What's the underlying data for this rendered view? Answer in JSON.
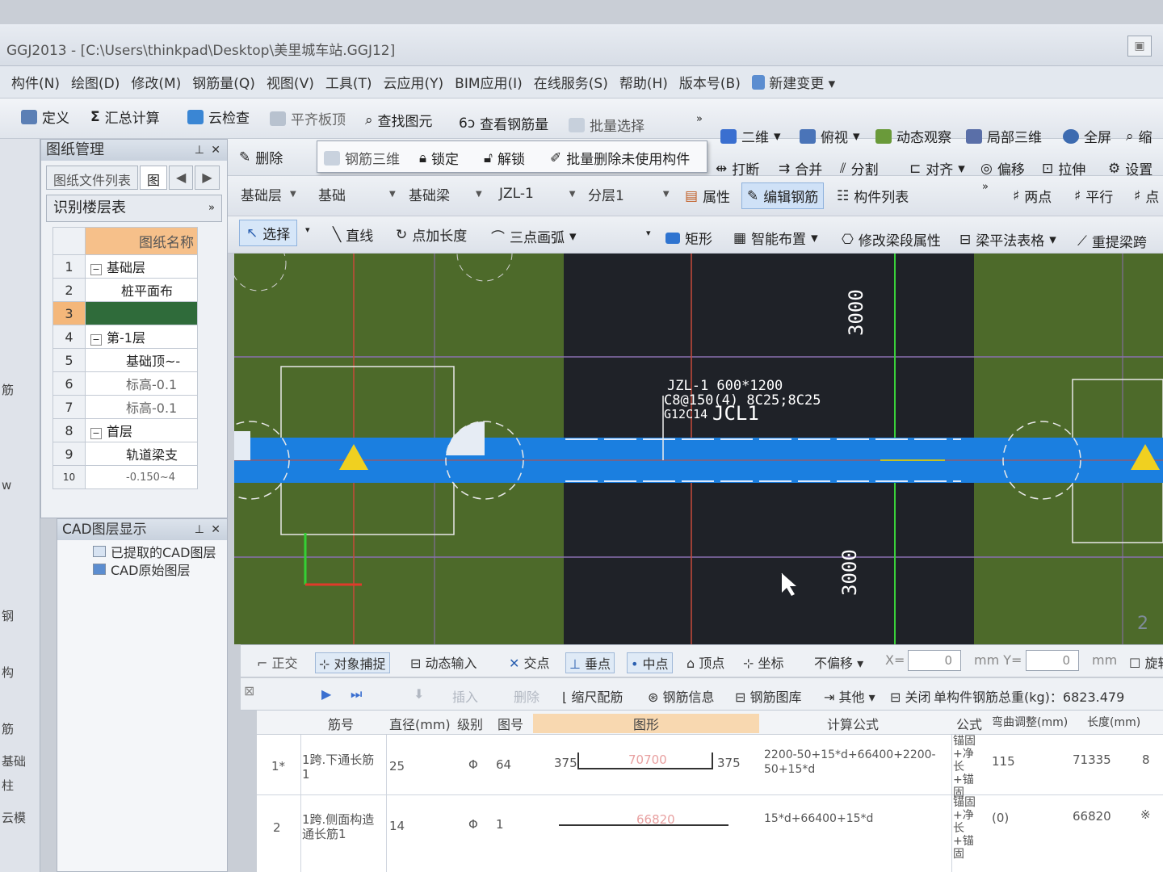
{
  "window": {
    "title": "GGJ2013 - [C:\\Users\\thinkpad\\Desktop\\美里城车站.GGJ12]"
  },
  "menu": [
    "构件(N)",
    "绘图(D)",
    "修改(M)",
    "钢筋量(Q)",
    "视图(V)",
    "工具(T)",
    "云应用(Y)",
    "BIM应用(I)",
    "在线服务(S)",
    "帮助(H)",
    "版本号(B)",
    "新建变更"
  ],
  "toolbar1": {
    "define": "定义",
    "sum": "汇总计算",
    "cloud_check": "云检查",
    "flat_slab": "平齐板顶",
    "find": "查找图元",
    "view_rebar": "查看钢筋量",
    "batch_select": "批量选择",
    "view2d": "二维",
    "top_view": "俯视",
    "dynamic": "动态观察",
    "local3d": "局部三维",
    "fullscreen": "全屏",
    "zoom": "缩"
  },
  "popup": {
    "rebar3d": "钢筋三维",
    "lock": "锁定",
    "unlock": "解锁",
    "batch_delete": "批量删除未使用构件"
  },
  "toolbar2": {
    "delete": "删除",
    "break": "打断",
    "merge": "合并",
    "split": "分割",
    "align": "对齐",
    "offset": "偏移",
    "stretch": "拉伸",
    "settings": "设置"
  },
  "toolbar3": {
    "layer": "基础层",
    "category": "基础",
    "type": "基础梁",
    "element": "JZL-1",
    "sublayer": "分层1",
    "properties": "属性",
    "edit_rebar": "编辑钢筋",
    "component_list": "构件列表",
    "two_points": "两点",
    "parallel": "平行",
    "point_angle": "点"
  },
  "toolbar4": {
    "select": "选择",
    "line": "直线",
    "add_length": "点加长度",
    "arc": "三点画弧",
    "rect": "矩形",
    "smart_layout": "智能布置",
    "modify_segment": "修改梁段属性",
    "beam_table": "梁平法表格",
    "re_span": "重提梁跨"
  },
  "left_panel": {
    "title": "图纸管理",
    "tab1": "图纸文件列表",
    "tab2": "图",
    "section": "识别楼层表",
    "column": "图纸名称",
    "rows": [
      {
        "n": "1",
        "name": "基础层",
        "expand": "−"
      },
      {
        "n": "2",
        "name": "桩平面布",
        "expand": ""
      },
      {
        "n": "3",
        "name": "",
        "expand": ""
      },
      {
        "n": "4",
        "name": "第-1层",
        "expand": "−"
      },
      {
        "n": "5",
        "name": "基础顶~-",
        "expand": ""
      },
      {
        "n": "6",
        "name": "标高-0.1",
        "expand": ""
      },
      {
        "n": "7",
        "name": "标高-0.1",
        "expand": ""
      },
      {
        "n": "8",
        "name": "首层",
        "expand": "−"
      },
      {
        "n": "9",
        "name": "轨道梁支",
        "expand": ""
      },
      {
        "n": "10",
        "name": "-0.150~4",
        "expand": ""
      }
    ],
    "side_labels": [
      "筋",
      "基础",
      "构",
      "w",
      "钢",
      "构",
      "筋",
      "基础",
      "柱",
      "云模"
    ]
  },
  "cad_panel": {
    "title": "CAD图层显示",
    "items": [
      "已提取的CAD图层",
      "CAD原始图层"
    ]
  },
  "canvas": {
    "beam_label_1": "JZL-1 600*1200",
    "beam_label_2": "C8@150(4) 8C25;8C25",
    "beam_label_3": "G12C14",
    "beam_label_4": "JCL1",
    "dim_top": "3000",
    "dim_bottom": "3000",
    "corner_num": "2"
  },
  "status_bar": {
    "ortho": "正交",
    "snap": "对象捕捉",
    "dynamic_input": "动态输入",
    "intersect": "交点",
    "perpendicular": "垂点",
    "midpoint": "中点",
    "vertex": "顶点",
    "coord": "坐标",
    "no_offset": "不偏移",
    "x_label": "X=",
    "x_value": "0",
    "y_label": "mm  Y=",
    "y_value": "0",
    "unit": "mm",
    "rotate": "旋转"
  },
  "rebar_toolbar": {
    "insert": "插入",
    "delete": "删除",
    "ruler": "缩尺配筋",
    "info": "钢筋信息",
    "library": "钢筋图库",
    "other": "其他",
    "close": "关闭",
    "total": "单构件钢筋总重(kg)：6823.479"
  },
  "rebar_table": {
    "headers": [
      "筋号",
      "直径(mm)",
      "级别",
      "图号",
      "图形",
      "计算公式",
      "公式",
      "弯曲调整(mm)",
      "长度(mm)"
    ],
    "rows": [
      {
        "idx": "1*",
        "name": "1跨.下通长筋1",
        "dia": "25",
        "grade": "Φ",
        "fig": "64",
        "left": "375",
        "mid": "70700",
        "right": "375",
        "formula": "2200-50+15*d+66400+2200-50+15*d",
        "desc": "锚固+净长+锚固",
        "bend": "115",
        "length": "71335",
        "extra": "8"
      },
      {
        "idx": "2",
        "name": "1跨.侧面构造通长筋1",
        "dia": "14",
        "grade": "Φ",
        "fig": "1",
        "left": "",
        "mid": "66820",
        "right": "",
        "formula": "15*d+66400+15*d",
        "desc": "锚固+净长+锚固",
        "bend": "(0)",
        "length": "66820",
        "extra": "※"
      }
    ]
  }
}
